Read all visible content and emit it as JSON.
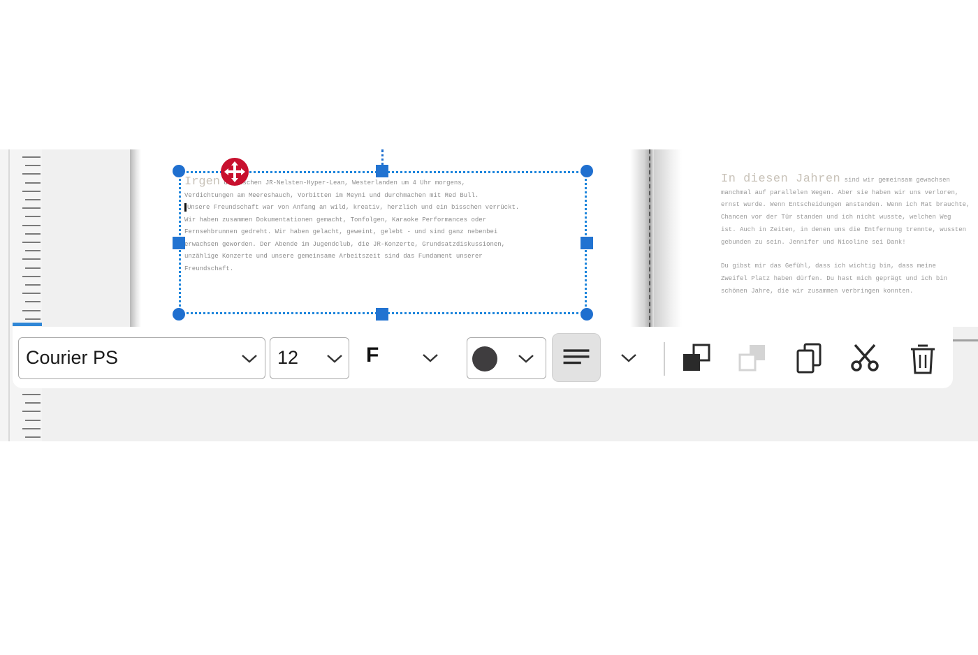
{
  "page1": {
    "text_lines": [
      {
        "lead": "Irgen",
        "rest": "d zwischen JR-Nelsten-Hyper-Lean, Westerlanden um 4 Uhr morgens,"
      },
      {
        "lead": "",
        "rest": "Verdichtungen am Meereshauch, Vorbitten im Meyni und durchmachen mit Red Bull."
      },
      {
        "lead": "",
        "rest": "Unsere Freundschaft war von Anfang an wild, kreativ, herzlich und ein bisschen verrückt."
      },
      {
        "lead": "",
        "rest": "Wir haben zusammen Dokumentationen gemacht, Tonfolgen, Karaoke Performances oder"
      },
      {
        "lead": "",
        "rest": "Fernsehbrunnen gedreht. Wir haben gelacht, geweint, gelebt - und sind ganz nebenbei"
      },
      {
        "lead": "",
        "rest": "erwachsen geworden. Der Abende im Jugendclub, die JR-Konzerte, Grundsatzdiskussionen,"
      },
      {
        "lead": "",
        "rest": "unzählige Konzerte und unsere gemeinsame Arbeitszeit sind das Fundament unserer"
      },
      {
        "lead": "",
        "rest": "Freundschaft."
      }
    ]
  },
  "page2": {
    "heading": "In diesen Jahren",
    "heading_rest": "sind wir gemeinsam gewachsen",
    "lines": [
      "manchmal auf parallelen Wegen. Aber sie haben wir uns verloren,",
      "ernst wurde. Wenn Entscheidungen anstanden. Wenn ich Rat brauchte,",
      "Chancen vor der Tür standen und ich nicht wusste, welchen Weg",
      "ist. Auch in Zeiten, in denen uns die Entfernung trennte, wussten",
      "gebunden zu sein. Jennifer und Nicoline sei Dank!"
    ],
    "lines2": [
      "Du gibst mir das Gefühl, dass ich wichtig bin, dass meine",
      "Zweifel Platz haben dürfen. Du hast mich geprägt und ich bin",
      "schönen Jahre, die wir zusammen verbringen konnten."
    ]
  },
  "toolbar": {
    "font_family": "Courier PS",
    "font_size": "12",
    "bold_label": "F",
    "text_color": "#3f3d3f",
    "alignment": "align-left",
    "icons": [
      "bring-to-front-icon",
      "send-to-back-icon",
      "copy-icon",
      "cut-icon",
      "delete-icon"
    ]
  },
  "colors": {
    "selection": "#1f86dc",
    "move_handle": "#c8102e",
    "ruler_marker": "#2f86d6"
  }
}
